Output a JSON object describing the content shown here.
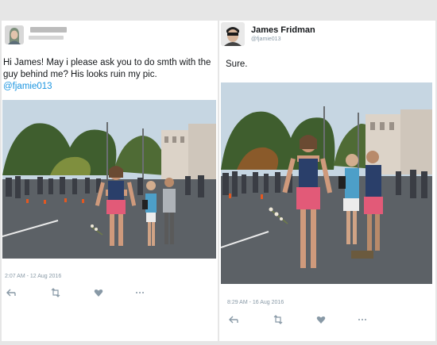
{
  "left_tweet": {
    "author_name": "",
    "author_handle": "",
    "text": "Hi James! May i please ask you to do smth with the guy behind me? His looks ruin my pic.",
    "mention": "@fjamie013",
    "timestamp": "2:07 AM - 12 Aug 2016",
    "actions": [
      {
        "icon": "reply-icon"
      },
      {
        "icon": "retweet-icon"
      },
      {
        "icon": "like-icon"
      },
      {
        "icon": "more-icon"
      }
    ]
  },
  "right_tweet": {
    "author_name": "James Fridman",
    "author_handle": "@fjamie013",
    "text": "Sure.",
    "timestamp": "8:29 AM - 16 Aug 2016",
    "actions": [
      {
        "icon": "reply-icon"
      },
      {
        "icon": "retweet-icon"
      },
      {
        "icon": "like-icon"
      },
      {
        "icon": "more-icon"
      }
    ]
  },
  "colors": {
    "link": "#1b95e0",
    "meta_text": "#8899a6",
    "skirt": "#e25a78",
    "top": "#2a3f6a",
    "icon": "#8899a6"
  }
}
